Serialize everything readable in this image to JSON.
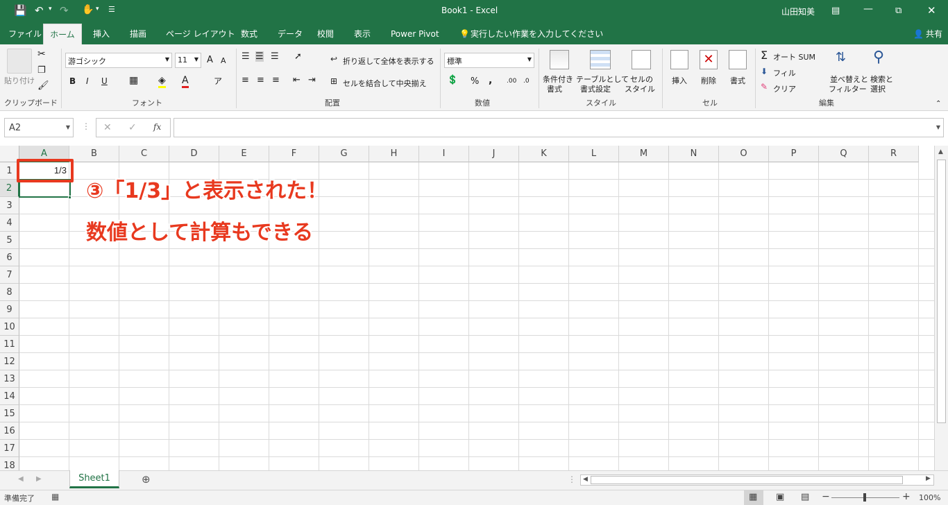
{
  "window": {
    "title": "Book1  -  Excel",
    "user": "山田知美"
  },
  "qat": {
    "save": "save-icon",
    "undo": "undo-icon",
    "redo": "redo-icon",
    "touch": "touch-icon"
  },
  "tabs": [
    "ファイル",
    "ホーム",
    "挿入",
    "描画",
    "ページ レイアウト",
    "数式",
    "データ",
    "校閲",
    "表示",
    "Power Pivot"
  ],
  "tell_me": "実行したい作業を入力してください",
  "share": "共有",
  "ribbon": {
    "clipboard": {
      "paste": "貼り付け",
      "label": "クリップボード"
    },
    "font": {
      "name": "游ゴシック",
      "size": "11",
      "bold": "B",
      "italic": "I",
      "underline": "U",
      "grow": "A",
      "shrink": "A",
      "color_letter": "A",
      "label": "フォント"
    },
    "align": {
      "wrap": "折り返して全体を表示する",
      "merge": "セルを結合して中央揃え",
      "label": "配置"
    },
    "number": {
      "format": "標準",
      "percent": "%",
      "comma": ",",
      "label": "数値"
    },
    "styles": {
      "cond": "条件付き",
      "cond2": "書式",
      "table": "テーブルとして",
      "table2": "書式設定",
      "cell": "セルの",
      "cell2": "スタイル",
      "label": "スタイル"
    },
    "cells": {
      "insert": "挿入",
      "delete": "削除",
      "format": "書式",
      "label": "セル"
    },
    "edit": {
      "autosum": "オート SUM",
      "fill": "フィル",
      "clear": "クリア",
      "sort": "並べ替えと",
      "sort2": "フィルター",
      "find": "検索と",
      "find2": "選択",
      "label": "編集"
    }
  },
  "namebox": "A2",
  "formula": "",
  "columns": [
    "A",
    "B",
    "C",
    "D",
    "E",
    "F",
    "G",
    "H",
    "I",
    "J",
    "K",
    "L",
    "M",
    "N",
    "O",
    "P",
    "Q",
    "R"
  ],
  "rows": [
    "1",
    "2",
    "3",
    "4",
    "5",
    "6",
    "7",
    "8",
    "9",
    "10",
    "11",
    "12",
    "13",
    "14",
    "15",
    "16",
    "17",
    "18"
  ],
  "cells": {
    "A1": "1/3"
  },
  "callout": {
    "line1": "③「1/3」と表示された！",
    "line2": "数値として計算もできる"
  },
  "sheet_tab": "Sheet1",
  "status": {
    "ready": "準備完了",
    "zoom": "100%"
  },
  "colors": {
    "brand": "#217346",
    "callout": "#e8391f"
  }
}
